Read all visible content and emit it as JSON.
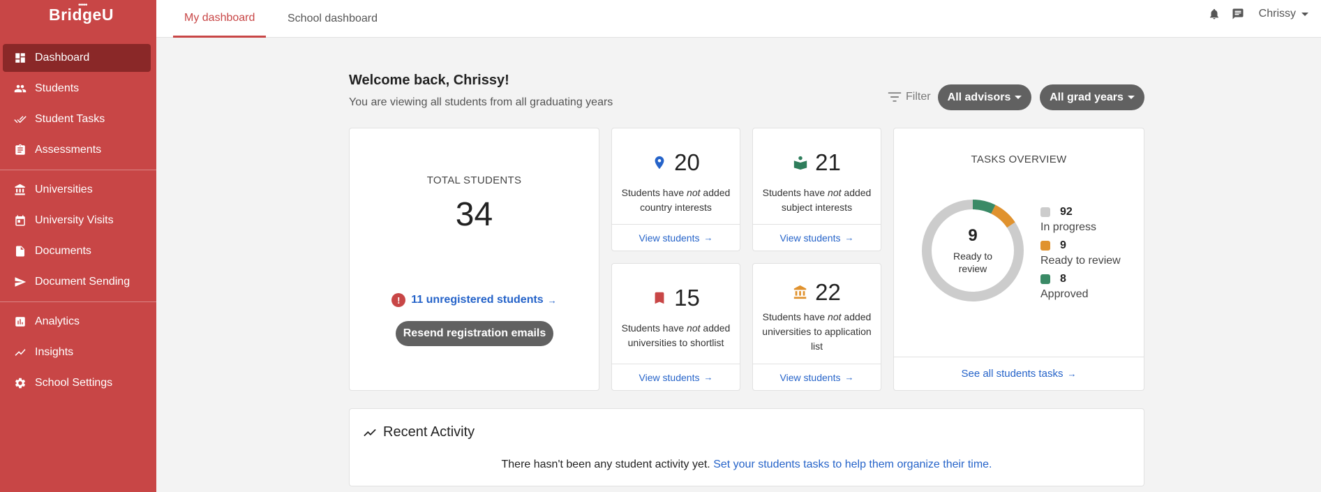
{
  "brand": {
    "name": "BridgeU",
    "dots": "•••••"
  },
  "sidebar": {
    "items": [
      {
        "label": "Dashboard",
        "icon": "dashboard-icon"
      },
      {
        "label": "Students",
        "icon": "people-icon"
      },
      {
        "label": "Student Tasks",
        "icon": "double-check-icon"
      },
      {
        "label": "Assessments",
        "icon": "clipboard-icon"
      },
      {
        "label": "Universities",
        "icon": "institution-icon"
      },
      {
        "label": "University Visits",
        "icon": "calendar-icon"
      },
      {
        "label": "Documents",
        "icon": "document-icon"
      },
      {
        "label": "Document Sending",
        "icon": "send-icon"
      },
      {
        "label": "Analytics",
        "icon": "bar-chart-icon"
      },
      {
        "label": "Insights",
        "icon": "trend-line-icon"
      },
      {
        "label": "School Settings",
        "icon": "gear-icon"
      }
    ]
  },
  "topbar": {
    "tabs": [
      {
        "label": "My dashboard"
      },
      {
        "label": "School dashboard"
      }
    ],
    "user": "Chrissy"
  },
  "main": {
    "welcome": "Welcome back, Chrissy!",
    "subtitle": "You are viewing all students from all graduating years",
    "filter_label": "Filter",
    "advisors_label": "All advisors",
    "grad_years_label": "All grad years"
  },
  "total": {
    "label": "TOTAL STUDENTS",
    "value": "34",
    "unregistered": "11 unregistered students",
    "resend": "Resend registration emails"
  },
  "stats": [
    {
      "value": "20",
      "pre": "Students have ",
      "em": "not",
      "post": " added country interests",
      "link": "View students",
      "icon": "map-pin-icon",
      "color": "#2563c9"
    },
    {
      "value": "21",
      "pre": "Students have ",
      "em": "not",
      "post": " added subject interests",
      "link": "View students",
      "icon": "reader-book-icon",
      "color": "#2e7d5b"
    },
    {
      "value": "15",
      "pre": "Students have ",
      "em": "not",
      "post": " added universities to shortlist",
      "link": "View students",
      "icon": "bookmark-icon",
      "color": "#c84646"
    },
    {
      "value": "22",
      "pre": "Students have ",
      "em": "not",
      "post": " added universities to application list",
      "link": "View students",
      "icon": "institution-icon",
      "color": "#e0922e"
    }
  ],
  "tasks": {
    "title": "TASKS OVERVIEW",
    "center_value": "9",
    "center_label": "Ready to review",
    "legend": [
      {
        "value": "92",
        "label": "In progress",
        "color": "#cccccc"
      },
      {
        "value": "9",
        "label": "Ready to review",
        "color": "#e0922e"
      },
      {
        "value": "8",
        "label": "Approved",
        "color": "#3a8a66"
      }
    ],
    "link": "See all students tasks"
  },
  "recent": {
    "title": "Recent Activity",
    "message": "There hasn't been any student activity yet.",
    "link": "Set your students tasks to help them organize their time."
  }
}
